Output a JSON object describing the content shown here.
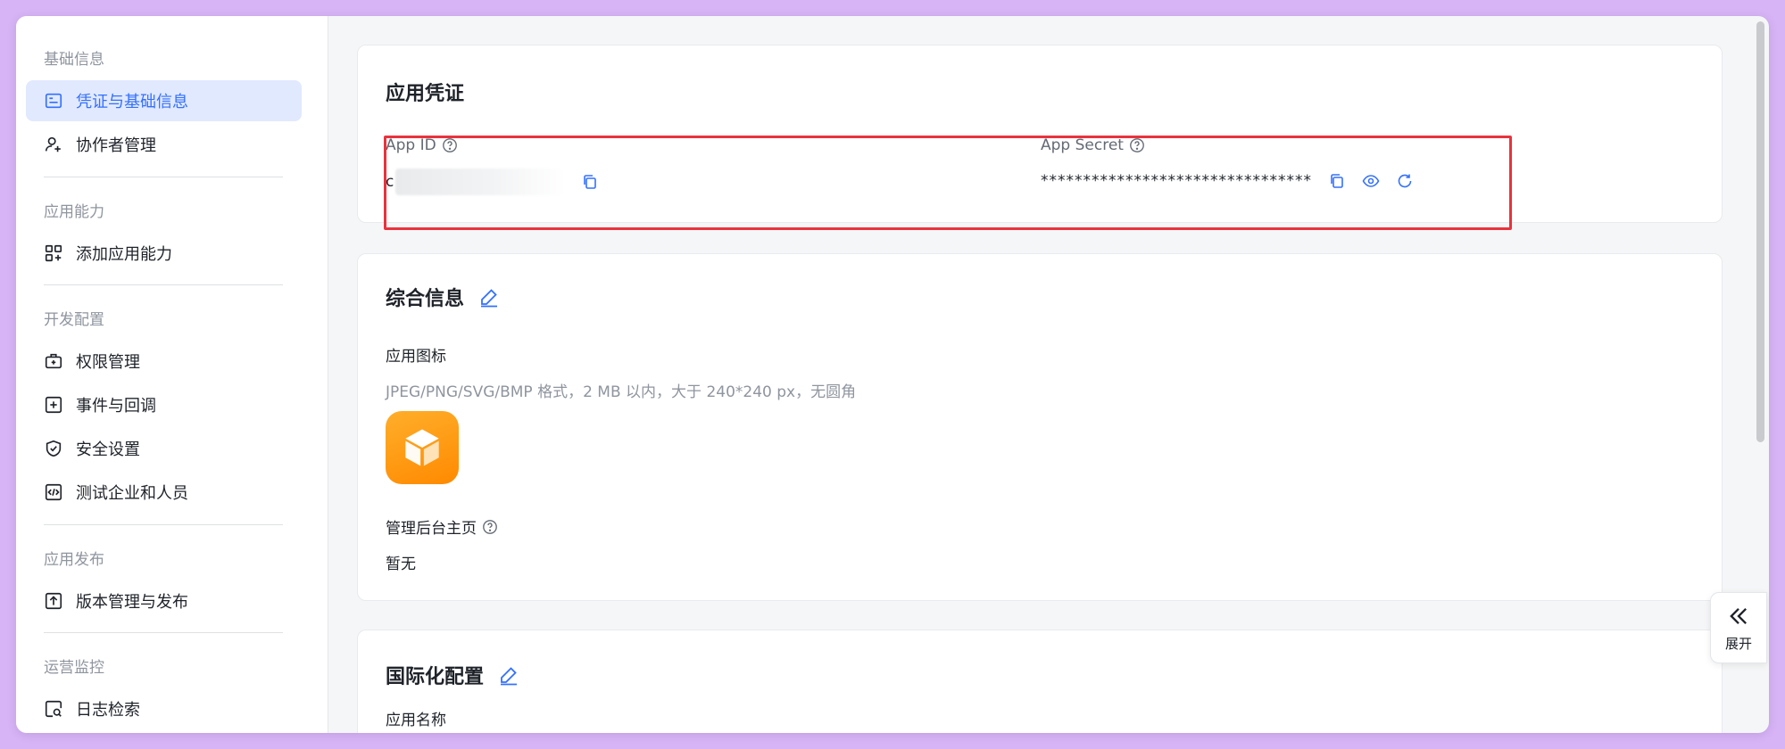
{
  "sidebar": {
    "sections": [
      {
        "label": "基础信息"
      },
      {
        "label": "应用能力"
      },
      {
        "label": "开发配置"
      },
      {
        "label": "应用发布"
      },
      {
        "label": "运营监控"
      }
    ],
    "items": [
      {
        "label": "凭证与基础信息",
        "icon": "credential-icon",
        "active": true
      },
      {
        "label": "协作者管理",
        "icon": "add-user-icon"
      },
      {
        "label": "添加应用能力",
        "icon": "grid-add-icon"
      },
      {
        "label": "权限管理",
        "icon": "briefcase-icon"
      },
      {
        "label": "事件与回调",
        "icon": "plus-square-icon"
      },
      {
        "label": "安全设置",
        "icon": "shield-check-icon"
      },
      {
        "label": "测试企业和人员",
        "icon": "code-square-icon"
      },
      {
        "label": "版本管理与发布",
        "icon": "upload-square-icon"
      },
      {
        "label": "日志检索",
        "icon": "log-search-icon"
      }
    ]
  },
  "credentials": {
    "title": "应用凭证",
    "app_id_label": "App ID",
    "app_id_value": "c",
    "app_secret_label": "App Secret",
    "app_secret_value": "********************************"
  },
  "general": {
    "title": "综合信息",
    "icon_label": "应用图标",
    "icon_hint": "JPEG/PNG/SVG/BMP 格式，2 MB 以内，大于 240*240 px，无圆角",
    "admin_home_label": "管理后台主页",
    "admin_home_value": "暂无"
  },
  "i18n": {
    "title": "国际化配置",
    "app_name_label": "应用名称"
  },
  "expand": {
    "label": "展开"
  },
  "colors": {
    "accent": "#3370ff",
    "highlight": "#e8333d",
    "app_icon": "#ff9a0e"
  }
}
